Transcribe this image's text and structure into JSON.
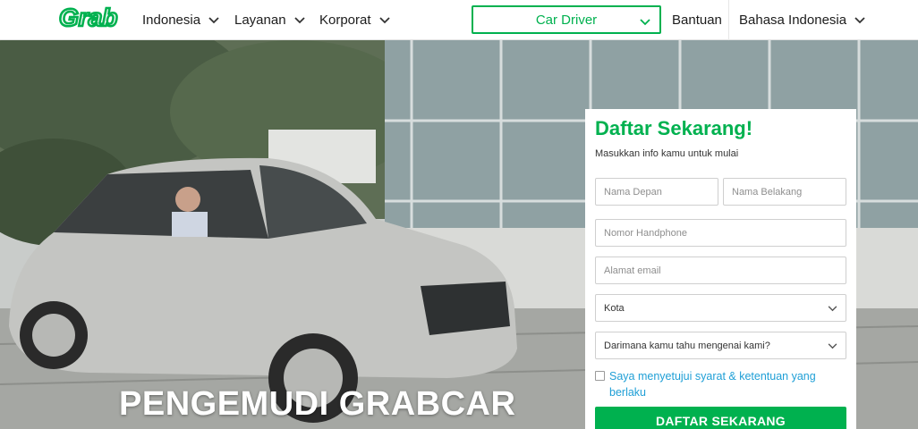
{
  "brand": {
    "logo_text": "Grab",
    "accent": "#00b14f"
  },
  "nav": {
    "country": "Indonesia",
    "services": "Layanan",
    "corporate": "Korporat",
    "role_selected": "Car Driver",
    "help": "Bantuan",
    "language": "Bahasa Indonesia"
  },
  "hero": {
    "headline": "PENGEMUDI GRABCAR"
  },
  "form": {
    "title": "Daftar Sekarang!",
    "subtitle": "Masukkan info kamu untuk mulai",
    "first_name_placeholder": "Nama Depan",
    "last_name_placeholder": "Nama Belakang",
    "phone_placeholder": "Nomor Handphone",
    "email_placeholder": "Alamat email",
    "city_selected": "Kota",
    "source_selected": "Darimana kamu tahu mengenai kami?",
    "agree_text": "Saya menyetujui syarat & ketentuan yang berlaku",
    "submit_label": "DAFTAR SEKARANG"
  }
}
